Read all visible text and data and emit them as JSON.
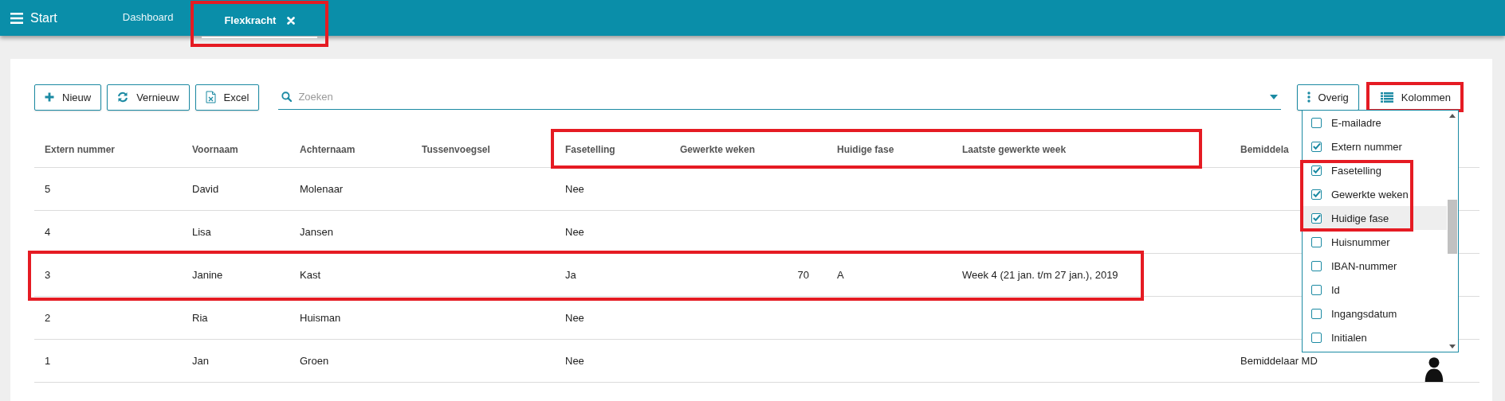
{
  "nav": {
    "title": "Start",
    "tabs": [
      {
        "label": "Dashboard",
        "selected": false,
        "closable": false,
        "highlighted": false
      },
      {
        "label": "Flexkracht",
        "selected": true,
        "closable": true,
        "highlighted": true
      }
    ]
  },
  "toolbar": {
    "buttons": [
      {
        "label": "Nieuw"
      },
      {
        "label": "Vernieuw"
      },
      {
        "label": "Excel"
      }
    ],
    "search": {
      "placeholder": "Zoeken"
    },
    "right_buttons": [
      {
        "label": "Overig",
        "highlighted": false
      },
      {
        "label": "Kolommen",
        "highlighted": true
      }
    ]
  },
  "table": {
    "columns": [
      {
        "label": "Extern nummer",
        "highlighted": false
      },
      {
        "label": "Voornaam",
        "highlighted": false
      },
      {
        "label": "Achternaam",
        "highlighted": false
      },
      {
        "label": "Tussenvoegsel",
        "highlighted": false
      },
      {
        "label": "Fasetelling",
        "highlighted": true
      },
      {
        "label": "Gewerkte weken",
        "highlighted": true
      },
      {
        "label": "Huidige fase",
        "highlighted": true
      },
      {
        "label": "Laatste gewerkte week",
        "highlighted": true
      },
      {
        "label": "Bemiddela",
        "highlighted": false
      }
    ],
    "rows": [
      {
        "extern_nummer": "5",
        "voornaam": "David",
        "achternaam": "Molenaar",
        "fasetelling": "Nee",
        "highlighted": false
      },
      {
        "extern_nummer": "4",
        "voornaam": "Lisa",
        "achternaam": "Jansen",
        "fasetelling": "Nee",
        "highlighted": false
      },
      {
        "extern_nummer": "3",
        "voornaam": "Janine",
        "achternaam": "Kast",
        "fasetelling": "Ja",
        "gewerkte_weken": "70",
        "huidige_fase": "A",
        "laatste_gewerkte_week": "Week 4 (21 jan. t/m 27 jan.), 2019",
        "highlighted": true
      },
      {
        "extern_nummer": "2",
        "voornaam": "Ria",
        "achternaam": "Huisman",
        "fasetelling": "Nee",
        "highlighted": false
      },
      {
        "extern_nummer": "1",
        "voornaam": "Jan",
        "achternaam": "Groen",
        "fasetelling": "Nee",
        "bemiddelaar": "Bemiddelaar MD",
        "avatar": true,
        "highlighted": false
      }
    ]
  },
  "column_menu": {
    "items": [
      {
        "label": "E-mailadre",
        "checked": false,
        "hovered": false,
        "highlighted": false
      },
      {
        "label": "Extern nummer",
        "checked": true,
        "hovered": false,
        "highlighted": false
      },
      {
        "label": "Fasetelling",
        "checked": true,
        "hovered": false,
        "highlighted": true
      },
      {
        "label": "Gewerkte weken",
        "checked": true,
        "hovered": false,
        "highlighted": true
      },
      {
        "label": "Huidige fase",
        "checked": true,
        "hovered": true,
        "highlighted": true
      },
      {
        "label": "Huisnummer",
        "checked": false,
        "hovered": false,
        "highlighted": false
      },
      {
        "label": "IBAN-nummer",
        "checked": false,
        "hovered": false,
        "highlighted": false
      },
      {
        "label": "Id",
        "checked": false,
        "hovered": false,
        "highlighted": false
      },
      {
        "label": "Ingangsdatum",
        "checked": false,
        "hovered": false,
        "highlighted": false
      },
      {
        "label": "Initialen",
        "checked": false,
        "hovered": false,
        "highlighted": false
      }
    ]
  }
}
